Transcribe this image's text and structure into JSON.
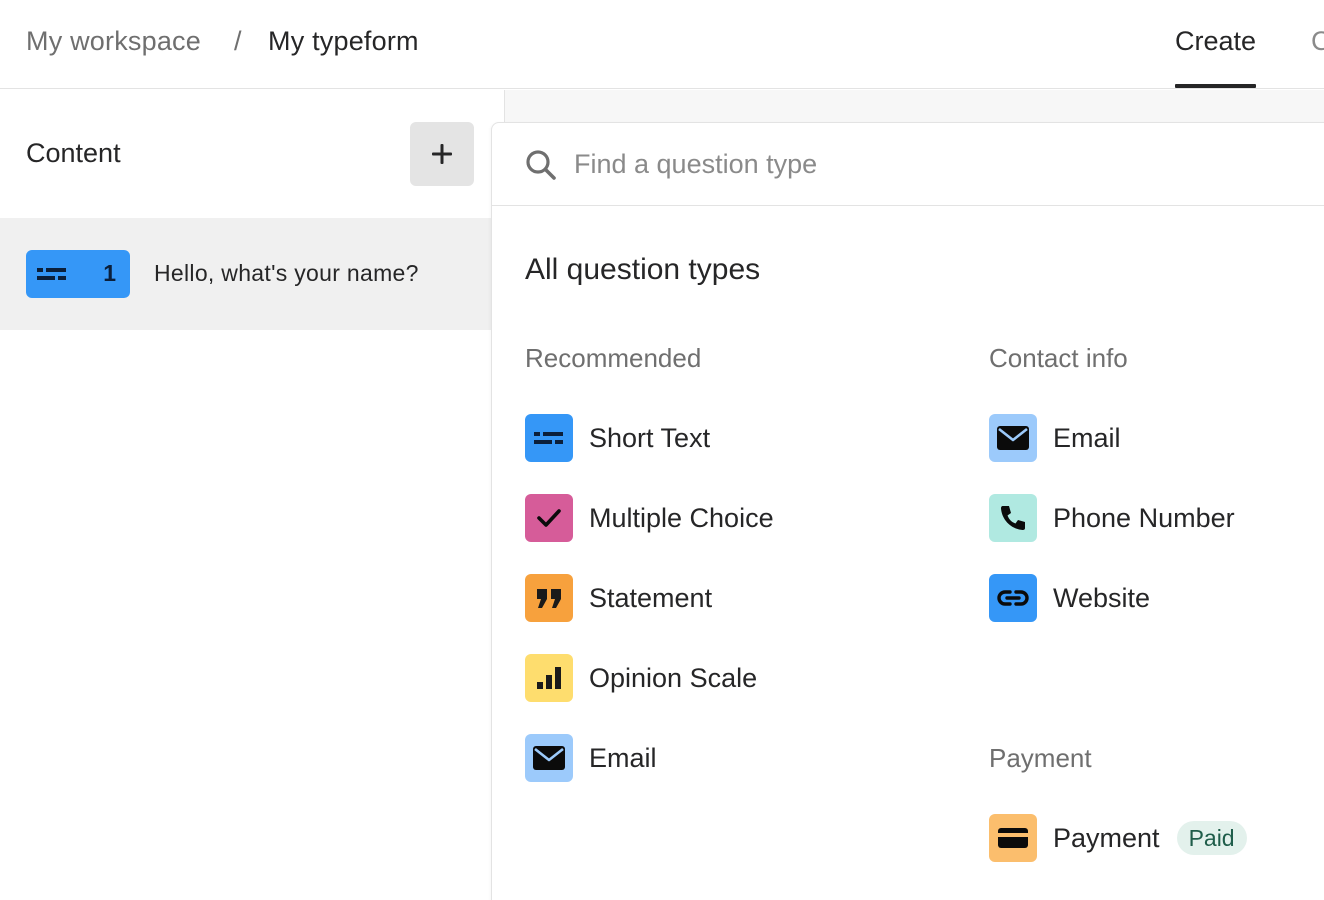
{
  "breadcrumb": {
    "workspace": "My workspace",
    "separator": "/",
    "form": "My typeform"
  },
  "tabs": [
    {
      "label": "Create",
      "active": true
    },
    {
      "label": "C",
      "active": false
    }
  ],
  "sidebar": {
    "title": "Content",
    "add_icon": "plus-icon",
    "questions": [
      {
        "number": "1",
        "text": "Hello, what's your name?",
        "icon": "short-text-icon",
        "color": "#3597f7"
      }
    ]
  },
  "search": {
    "placeholder": "Find a question type",
    "value": ""
  },
  "picker": {
    "title": "All question types",
    "recommended": {
      "title": "Recommended",
      "items": [
        {
          "label": "Short Text",
          "icon": "short-text-icon",
          "color": "#3597f7"
        },
        {
          "label": "Multiple Choice",
          "icon": "check-icon",
          "color": "#d65c99"
        },
        {
          "label": "Statement",
          "icon": "quote-icon",
          "color": "#f7a13d"
        },
        {
          "label": "Opinion Scale",
          "icon": "bar-chart-icon",
          "color": "#fedd6e"
        },
        {
          "label": "Email",
          "icon": "envelope-icon",
          "color": "#9ccafb"
        }
      ]
    },
    "contact": {
      "title": "Contact info",
      "items": [
        {
          "label": "Email",
          "icon": "envelope-icon",
          "color": "#9ccafb"
        },
        {
          "label": "Phone Number",
          "icon": "phone-icon",
          "color": "#b0e9e1"
        },
        {
          "label": "Website",
          "icon": "link-icon",
          "color": "#3597f7"
        }
      ]
    },
    "payment": {
      "title": "Payment",
      "items": [
        {
          "label": "Payment",
          "icon": "credit-card-icon",
          "color": "#fbbe6d",
          "badge": "Paid"
        }
      ]
    }
  }
}
